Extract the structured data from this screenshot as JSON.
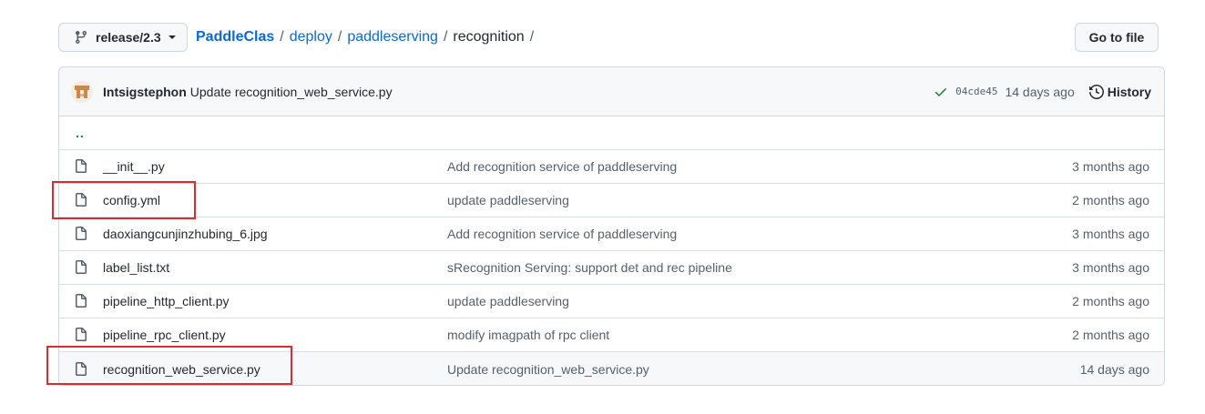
{
  "branch": {
    "label": "release/2.3"
  },
  "breadcrumb": {
    "repo": "PaddleClas",
    "parts": [
      "deploy",
      "paddleserving"
    ],
    "current": "recognition",
    "separator": "/"
  },
  "goto_file_label": "Go to file",
  "latest_commit": {
    "author": "Intsigstephon",
    "message": "Update recognition_web_service.py",
    "sha": "04cde45",
    "age": "14 days ago",
    "history_label": "History"
  },
  "parent_dir": "..",
  "files": [
    {
      "name": "__init__.py",
      "commit": "Add recognition service of paddleserving",
      "age": "3 months ago"
    },
    {
      "name": "config.yml",
      "commit": "update paddleserving",
      "age": "2 months ago"
    },
    {
      "name": "daoxiangcunjinzhubing_6.jpg",
      "commit": "Add recognition service of paddleserving",
      "age": "3 months ago"
    },
    {
      "name": "label_list.txt",
      "commit": "sRecognition Serving: support det and rec pipeline",
      "age": "3 months ago"
    },
    {
      "name": "pipeline_http_client.py",
      "commit": "update paddleserving",
      "age": "2 months ago"
    },
    {
      "name": "pipeline_rpc_client.py",
      "commit": "modify imagpath of rpc client",
      "age": "2 months ago"
    },
    {
      "name": "recognition_web_service.py",
      "commit": "Update recognition_web_service.py",
      "age": "14 days ago"
    }
  ],
  "colors": {
    "link": "#0969da",
    "highlight_box": "#e0292d",
    "check": "#1a7f37"
  }
}
